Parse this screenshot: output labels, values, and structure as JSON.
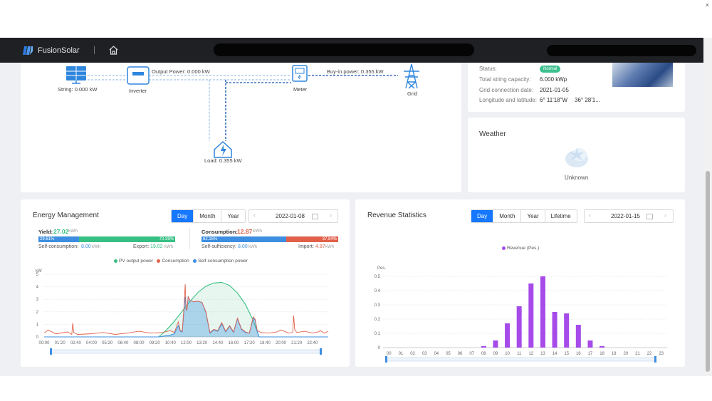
{
  "app": {
    "brand": "FusionSolar"
  },
  "flow": {
    "string_label": "String: 0.000 kW",
    "inverter_label": "Inverter",
    "output_power": "Output Power: 0.000 kW",
    "meter_label": "Meter",
    "buyin_power": "Buy-in power: 0.355 kW",
    "grid_label": "Grid",
    "load_label": "Load: 0.355 kW"
  },
  "plant_info": {
    "status_label": "Status:",
    "status_value": "Normal",
    "capacity_label": "Total string capacity:",
    "capacity_value": "6.000 kWp",
    "grid_date_label": "Grid connection date:",
    "grid_date_value": "2021-01-05",
    "lonlat_label": "Longitude and latitude:",
    "lon_value": "6° 11'18\"W",
    "lat_value": "36° 28'1..."
  },
  "weather": {
    "title": "Weather",
    "status": "Unknown"
  },
  "energy": {
    "title": "Energy Management",
    "tabs": [
      "Day",
      "Month",
      "Year"
    ],
    "active_tab": "Day",
    "date": "2022-01-08",
    "yield_label": "Yield:",
    "yield_value": "27.02",
    "yield_unit": "kWh",
    "yield_self_pct": "29.61%",
    "yield_export_pct": "70.39%",
    "yield_self_fraction": 0.2961,
    "self_consumption_label": "Self-consumption:",
    "self_consumption_value": "8.00",
    "export_label": "Export:",
    "export_value": "19.02",
    "consumption_label": "Consumption:",
    "consumption_value": "12.87",
    "consumption_unit": "kWh",
    "cons_self_pct": "62.16%",
    "cons_import_pct": "37.84%",
    "cons_self_fraction": 0.6216,
    "self_sufficiency_label": "Self-sufficiency:",
    "self_sufficiency_value": "8.00",
    "import_label": "Import:",
    "import_value": "4.87",
    "kwh": "kWh",
    "colors": {
      "pv": "#37c083",
      "consumption": "#e2604a",
      "self": "#3d8ee0",
      "import": "#e2604a"
    }
  },
  "revenue": {
    "title": "Revenue Statistics",
    "tabs": [
      "Day",
      "Month",
      "Year",
      "Lifetime"
    ],
    "active_tab": "Day",
    "date": "2022-01-15",
    "color": "#a64bea"
  },
  "chart_data": [
    {
      "type": "line",
      "ylabel": "kW",
      "ylim": [
        0,
        5
      ],
      "yticks": [
        0,
        1,
        2,
        3,
        4,
        5
      ],
      "xlim": [
        0,
        1440
      ],
      "x_tick_labels": [
        "00:00",
        "01:20",
        "02:40",
        "04:00",
        "05:20",
        "06:40",
        "08:00",
        "09:20",
        "10:40",
        "12:00",
        "13:20",
        "14:40",
        "16:00",
        "17:20",
        "18:40",
        "20:00",
        "21:20",
        "22:40"
      ],
      "legend": [
        "PV output power",
        "Consumption",
        "Self-consumption power"
      ],
      "legend_placement": "top-center",
      "grid": true,
      "series": [
        {
          "name": "PV output power",
          "color": "#37c083",
          "x": [
            580,
            620,
            660,
            700,
            740,
            780,
            820,
            860,
            900,
            940,
            980,
            1020,
            1060,
            1090
          ],
          "y": [
            0,
            0.55,
            1.25,
            2.05,
            2.85,
            3.55,
            4.05,
            4.3,
            4.35,
            4.1,
            3.5,
            2.6,
            1.3,
            0
          ]
        },
        {
          "name": "Consumption",
          "color": "#e2604a",
          "x": [
            0,
            20,
            60,
            120,
            140,
            145,
            150,
            170,
            240,
            300,
            360,
            420,
            480,
            540,
            600,
            640,
            660,
            680,
            690,
            700,
            710,
            715,
            720,
            725,
            730,
            740,
            760,
            780,
            800,
            820,
            840,
            860,
            880,
            900,
            920,
            940,
            960,
            980,
            1000,
            1020,
            1040,
            1060,
            1070,
            1080,
            1100,
            1140,
            1180,
            1200,
            1240,
            1260,
            1265,
            1270,
            1280,
            1320,
            1360,
            1390,
            1400,
            1420,
            1440
          ],
          "y": [
            0.3,
            0.55,
            0.25,
            0.4,
            0.2,
            1.1,
            0.35,
            0.2,
            0.25,
            0.35,
            0.2,
            0.3,
            0.45,
            0.3,
            0.35,
            0.5,
            0.35,
            1.2,
            0.5,
            0.45,
            2.6,
            4.2,
            2.1,
            2.3,
            3.2,
            2.9,
            2.8,
            2.85,
            2.75,
            2.0,
            0.35,
            0.6,
            0.5,
            1.15,
            0.45,
            0.9,
            0.4,
            1.5,
            0.65,
            0.4,
            0.3,
            1.6,
            1.4,
            0.5,
            0.35,
            0.3,
            0.4,
            0.55,
            0.3,
            0.35,
            1.7,
            0.6,
            0.35,
            0.45,
            0.3,
            0.4,
            0.5,
            0.3,
            0.45
          ]
        },
        {
          "name": "Self-consumption power",
          "color": "#3d8ee0",
          "x": [
            0,
            580,
            640,
            660,
            680,
            690,
            700,
            710,
            715,
            720,
            725,
            730,
            740,
            760,
            780,
            800,
            820,
            840,
            860,
            880,
            900,
            920,
            940,
            960,
            980,
            1000,
            1020,
            1040,
            1060,
            1070,
            1080,
            1090,
            1440
          ],
          "y": [
            0,
            0,
            0.15,
            0.25,
            0.9,
            0.45,
            0.4,
            2.4,
            3.2,
            2.1,
            2.3,
            3.2,
            2.9,
            2.8,
            2.85,
            2.75,
            1.95,
            0.3,
            0.55,
            0.45,
            1.05,
            0.4,
            0.85,
            0.35,
            1.45,
            0.6,
            0.35,
            0.3,
            1.5,
            1.3,
            0.4,
            0,
            0
          ]
        }
      ]
    },
    {
      "type": "bar",
      "ylabel": "Pes.",
      "ylim": [
        0,
        0.5
      ],
      "yticks": [
        0,
        0.1,
        0.2,
        0.3,
        0.4,
        0.5
      ],
      "legend": [
        "Revenue (Pes.)"
      ],
      "legend_placement": "top-center",
      "grid": true,
      "categories": [
        "00",
        "01",
        "02",
        "03",
        "04",
        "05",
        "06",
        "07",
        "08",
        "09",
        "10",
        "11",
        "12",
        "13",
        "14",
        "15",
        "16",
        "17",
        "18",
        "19",
        "20",
        "21",
        "22",
        "23"
      ],
      "series": [
        {
          "name": "Revenue (Pes.)",
          "color": "#a64bea",
          "values": [
            0,
            0,
            0,
            0,
            0,
            0,
            0,
            0,
            0.01,
            0.05,
            0.17,
            0.29,
            0.45,
            0.5,
            0.25,
            0.24,
            0.16,
            0.05,
            0.01,
            0,
            0,
            0,
            0,
            0
          ]
        }
      ]
    }
  ]
}
